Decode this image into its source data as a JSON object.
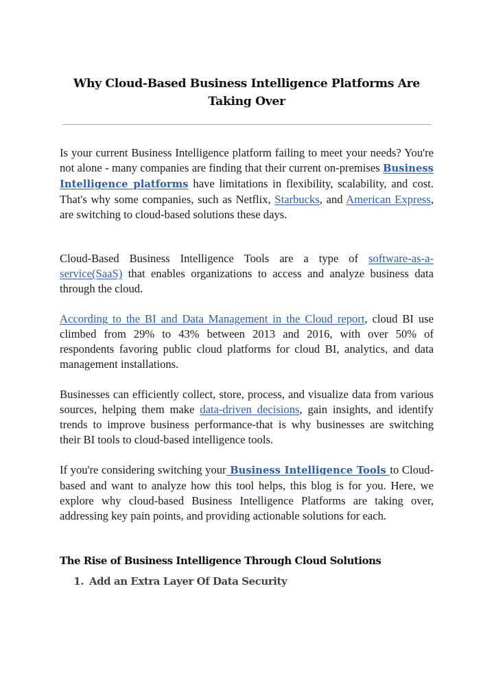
{
  "document": {
    "title": "Why Cloud-Based Business Intelligence Platforms Are Taking Over",
    "colors": {
      "text": "#1a1a1a",
      "link": "#2a5db0",
      "divider": "#a8a8a8",
      "subheading": "#444444"
    },
    "paragraphs": [
      {
        "segments": [
          {
            "text": "Is your current Business Intelligence platform failing to meet your needs? You're not alone - many companies are finding that their current on-premises "
          },
          {
            "text": "Business Intelligence platforms",
            "link": true,
            "bold": true
          },
          {
            "text": " have limitations in flexibility, scalability, and cost. That's why some companies, such as Netflix, "
          },
          {
            "text": "Starbucks",
            "link": true
          },
          {
            "text": ", and "
          },
          {
            "text": "American Express",
            "link": true
          },
          {
            "text": ", are switching to cloud-based solutions these days."
          }
        ]
      },
      {
        "segments": [
          {
            "text": "Cloud-Based Business Intelligence Tools are a type of "
          },
          {
            "text": "software-as-a-service(SaaS)",
            "link": true
          },
          {
            "text": " that enables organizations to access and analyze business data through the cloud."
          }
        ]
      },
      {
        "segments": [
          {
            "text": "According to the BI and Data Management in the Cloud report",
            "link": true
          },
          {
            "text": ", cloud BI use climbed from 29% to 43% between 2013 and 2016, with over 50% of respondents favoring public cloud platforms for cloud BI, analytics, and data management installations."
          }
        ]
      },
      {
        "segments": [
          {
            "text": "Businesses can efficiently collect, store, process, and visualize data from various sources, helping them make "
          },
          {
            "text": "data-driven decisions",
            "link": true
          },
          {
            "text": ", gain insights, and identify trends to improve business performance-that is why businesses are switching their BI tools to cloud-based intelligence tools."
          }
        ]
      },
      {
        "segments": [
          {
            "text": "If you're considering switching your"
          },
          {
            "text": " Business Intelligence Tools ",
            "link": true,
            "bold": true
          },
          {
            "text": "to Cloud-based and want to analyze how this tool helps, this blog is for you. Here, we explore why cloud-based Business Intelligence Platforms are taking over, addressing key pain points, and providing actionable solutions for each."
          }
        ]
      }
    ],
    "section_heading": "The Rise of Business Intelligence Through Cloud Solutions",
    "list_items": [
      {
        "number": "1.",
        "text": "Add an Extra Layer Of Data Security"
      }
    ]
  }
}
